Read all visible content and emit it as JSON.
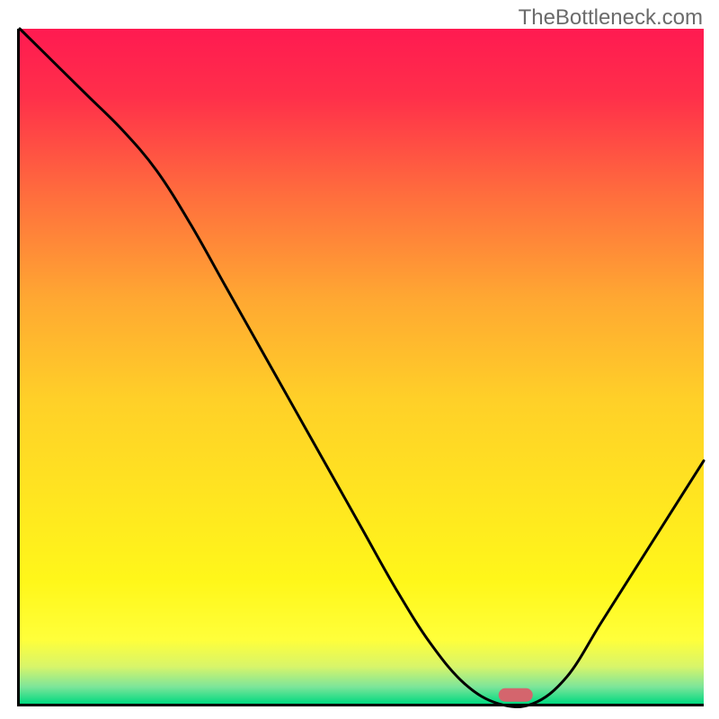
{
  "watermark": "TheBottleneck.com",
  "chart_data": {
    "type": "line",
    "title": "",
    "xlabel": "",
    "ylabel": "",
    "xlim": [
      0,
      100
    ],
    "ylim": [
      0,
      100
    ],
    "grid": false,
    "background": "vertical-gradient-red-to-green",
    "series": [
      {
        "name": "bottleneck-curve",
        "x": [
          0,
          5,
          10,
          15,
          20,
          25,
          30,
          35,
          40,
          45,
          50,
          55,
          60,
          65,
          70,
          75,
          80,
          85,
          90,
          95,
          100
        ],
        "values": [
          100,
          95,
          90,
          85,
          79,
          71,
          62,
          53,
          44,
          35,
          26,
          17,
          9,
          3,
          0,
          0,
          4,
          12,
          20,
          28,
          36
        ]
      }
    ],
    "marker": {
      "name": "low-point-marker",
      "x_center": 72.5,
      "x_range": [
        70,
        75
      ],
      "y": 1.3,
      "color": "#d4656d"
    },
    "gradient_stops": [
      {
        "pos": 0.0,
        "color": "#ff1a51"
      },
      {
        "pos": 0.1,
        "color": "#ff2f4a"
      },
      {
        "pos": 0.25,
        "color": "#ff6f3d"
      },
      {
        "pos": 0.4,
        "color": "#ffa832"
      },
      {
        "pos": 0.55,
        "color": "#ffd028"
      },
      {
        "pos": 0.7,
        "color": "#ffe620"
      },
      {
        "pos": 0.82,
        "color": "#fff71a"
      },
      {
        "pos": 0.905,
        "color": "#ffff3a"
      },
      {
        "pos": 0.945,
        "color": "#d8f56a"
      },
      {
        "pos": 0.975,
        "color": "#7de59a"
      },
      {
        "pos": 1.0,
        "color": "#00d980"
      }
    ]
  }
}
